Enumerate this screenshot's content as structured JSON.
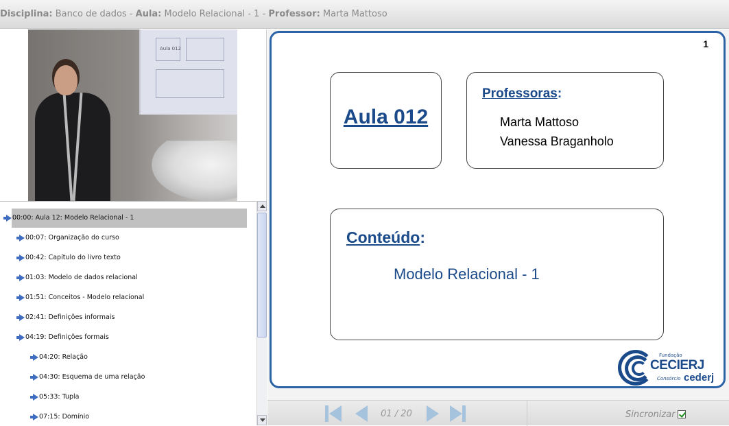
{
  "header": {
    "disciplina_label": "Disciplina:",
    "disciplina_value": "Banco de dados",
    "aula_label": "Aula:",
    "aula_value": "Modelo Relacional - 1",
    "professor_label": "Professor:",
    "professor_value": "Marta Mattoso",
    "sep": " - "
  },
  "video": {
    "screen_text": "Aula 012"
  },
  "toc": {
    "items": [
      {
        "label": "00:00: Aula 12: Modelo Relacional - 1",
        "level": 0,
        "selected": true
      },
      {
        "label": "00:07: Organização do curso",
        "level": 1
      },
      {
        "label": "00:42: Capítulo do livro texto",
        "level": 1
      },
      {
        "label": "01:03: Modelo de dados relacional",
        "level": 1
      },
      {
        "label": "01:51: Conceitos - Modelo relacional",
        "level": 1
      },
      {
        "label": "02:41: Definições informais",
        "level": 1
      },
      {
        "label": "04:19: Definições formais",
        "level": 1
      },
      {
        "label": "04:20: Relação",
        "level": 2
      },
      {
        "label": "04:30: Esquema de uma relação",
        "level": 2
      },
      {
        "label": "05:33: Tupla",
        "level": 2
      },
      {
        "label": "07:15: Domínio",
        "level": 2
      }
    ]
  },
  "slide": {
    "number": "1",
    "aula_title": "Aula 012",
    "professoras_label": "Professoras",
    "professoras_colon": ":",
    "professoras": [
      "Marta Mattoso",
      "Vanessa Braganholo"
    ],
    "conteudo_label": "Conteúdo",
    "conteudo_colon": ":",
    "conteudo_text": "Modelo Relacional - 1",
    "logo": {
      "fundacao": "Fundação",
      "cecierj": "CECIERJ",
      "consorcio": "Consórcio",
      "cederj": "cederj"
    }
  },
  "controls": {
    "page_indicator": "01 / 20",
    "sync_label": "Sincronizar",
    "sync_checked": true,
    "icon_color": "#a6c3dd"
  },
  "colors": {
    "accent": "#2b63a6",
    "slide_text": "#1b4a8b",
    "toc_arrow": "#3d6cc0"
  }
}
